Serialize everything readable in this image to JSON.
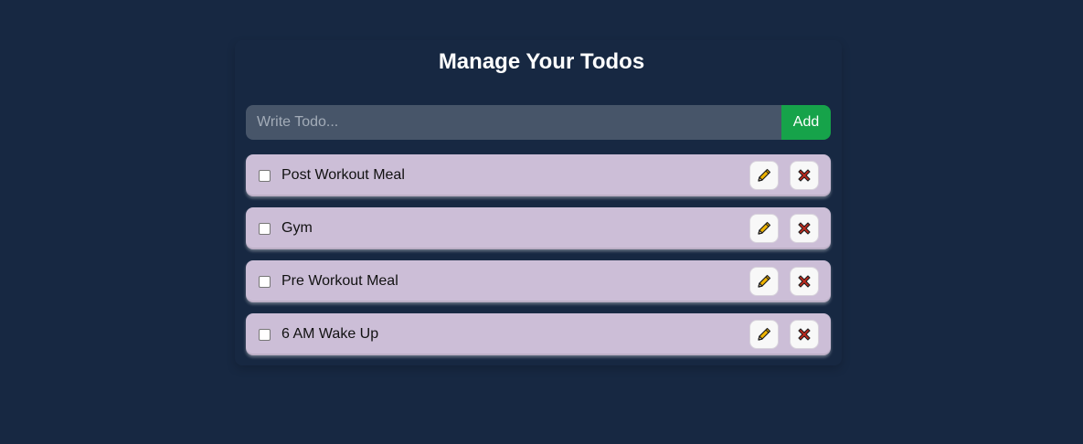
{
  "header": {
    "title": "Manage Your Todos"
  },
  "form": {
    "placeholder": "Write Todo...",
    "value": "",
    "add_label": "Add"
  },
  "todos": [
    {
      "text": "Post Workout Meal",
      "completed": false,
      "edit_icon": "pencil-icon",
      "delete_icon": "close-icon"
    },
    {
      "text": "Gym",
      "completed": false,
      "edit_icon": "pencil-icon",
      "delete_icon": "close-icon"
    },
    {
      "text": "Pre Workout Meal",
      "completed": false,
      "edit_icon": "pencil-icon",
      "delete_icon": "close-icon"
    },
    {
      "text": "6 AM Wake Up",
      "completed": false,
      "edit_icon": "pencil-icon",
      "delete_icon": "close-icon"
    }
  ],
  "colors": {
    "background": "#172842",
    "input_background": "#475569",
    "add_button": "#16a34a",
    "todo_item": "#ccbed7",
    "edit_icon": "#f0b400",
    "delete_icon": "#c0291d"
  }
}
